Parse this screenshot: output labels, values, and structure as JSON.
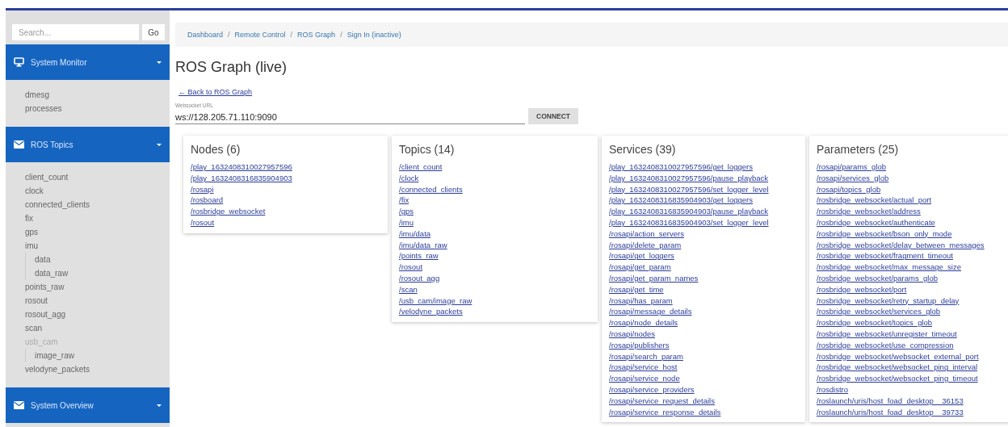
{
  "sidebar": {
    "search": {
      "placeholder": "Search...",
      "button": "Go"
    },
    "sections": [
      {
        "title": "System Monitor",
        "kind": "monitor",
        "items": [
          {
            "label": "dmesg",
            "disabled": false
          },
          {
            "label": "processes",
            "disabled": false
          }
        ]
      },
      {
        "title": "ROS Topics",
        "kind": "envelope",
        "items": [
          {
            "label": "client_count",
            "disabled": false
          },
          {
            "label": "clock",
            "disabled": false
          },
          {
            "label": "connected_clients",
            "disabled": false
          },
          {
            "label": "fix",
            "disabled": false
          },
          {
            "label": "gps",
            "disabled": false
          },
          {
            "label": "imu",
            "disabled": false,
            "children": [
              {
                "label": "data",
                "disabled": false
              },
              {
                "label": "data_raw",
                "disabled": false
              }
            ]
          },
          {
            "label": "points_raw",
            "disabled": false
          },
          {
            "label": "rosout",
            "disabled": false
          },
          {
            "label": "rosout_agg",
            "disabled": false
          },
          {
            "label": "scan",
            "disabled": false
          },
          {
            "label": "usb_cam",
            "disabled": true,
            "children": [
              {
                "label": "image_raw",
                "disabled": false
              }
            ]
          },
          {
            "label": "velodyne_packets",
            "disabled": false
          }
        ]
      },
      {
        "title": "System Overview",
        "kind": "envelope"
      }
    ]
  },
  "breadcrumbs": {
    "separator": "/",
    "items": [
      "Dashboard",
      "Remote Control",
      "ROS Graph",
      "Sign In (inactive)"
    ]
  },
  "page_title": "ROS Graph (live)",
  "back_link": "← Back to ROS Graph",
  "url_field": {
    "label": "Websocket URL",
    "value": "ws://128.205.71.110:9090"
  },
  "connect_button": "CONNECT",
  "panels": [
    {
      "title": "Nodes (6)",
      "links": [
        "/play_1632408310027957596",
        "/play_1632408316835904903",
        "/rosapi",
        "/rosboard",
        "/rosbridge_websocket",
        "/rosout"
      ]
    },
    {
      "title": "Topics (14)",
      "links": [
        "/client_count",
        "/clock",
        "/connected_clients",
        "/fix",
        "/gps",
        "/imu",
        "/imu/data",
        "/imu/data_raw",
        "/points_raw",
        "/rosout",
        "/rosout_agg",
        "/scan",
        "/usb_cam/image_raw",
        "/velodyne_packets"
      ]
    },
    {
      "title": "Services (39)",
      "links": [
        "/play_1632408310027957596/get_loggers",
        "/play_1632408310027957596/pause_playback",
        "/play_1632408310027957596/set_logger_level",
        "/play_1632408316835904903/get_loggers",
        "/play_1632408316835904903/pause_playback",
        "/play_1632408316835904903/set_logger_level",
        "/rosapi/action_servers",
        "/rosapi/delete_param",
        "/rosapi/get_loggers",
        "/rosapi/get_param",
        "/rosapi/get_param_names",
        "/rosapi/get_time",
        "/rosapi/has_param",
        "/rosapi/message_details",
        "/rosapi/node_details",
        "/rosapi/nodes",
        "/rosapi/publishers",
        "/rosapi/search_param",
        "/rosapi/service_host",
        "/rosapi/service_node",
        "/rosapi/service_providers",
        "/rosapi/service_request_details",
        "/rosapi/service_response_details"
      ]
    },
    {
      "title": "Parameters (25)",
      "links": [
        "/rosapi/params_glob",
        "/rosapi/services_glob",
        "/rosapi/topics_glob",
        "/rosbridge_websocket/actual_port",
        "/rosbridge_websocket/address",
        "/rosbridge_websocket/authenticate",
        "/rosbridge_websocket/bson_only_mode",
        "/rosbridge_websocket/delay_between_messages",
        "/rosbridge_websocket/fragment_timeout",
        "/rosbridge_websocket/max_message_size",
        "/rosbridge_websocket/params_glob",
        "/rosbridge_websocket/port",
        "/rosbridge_websocket/retry_startup_delay",
        "/rosbridge_websocket/services_glob",
        "/rosbridge_websocket/topics_glob",
        "/rosbridge_websocket/unregister_timeout",
        "/rosbridge_websocket/use_compression",
        "/rosbridge_websocket/websocket_external_port",
        "/rosbridge_websocket/websocket_ping_interval",
        "/rosbridge_websocket/websocket_ping_timeout",
        "/rosdistro",
        "/roslaunch/uris/host_foad_desktop__36153",
        "/roslaunch/uris/host_foad_desktop__39733"
      ]
    }
  ]
}
